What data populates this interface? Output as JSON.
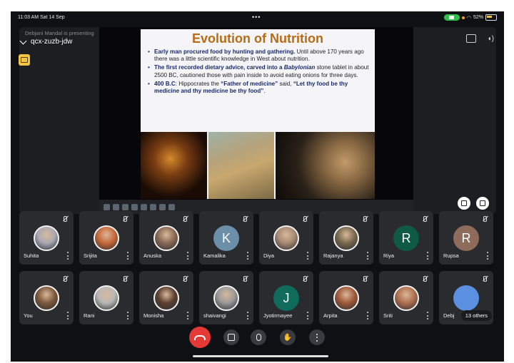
{
  "status": {
    "time": "11:03 AM  Sat 14 Sep",
    "battery": "52%"
  },
  "meeting": {
    "presenting": "Debjani Mandal is presenting",
    "code": "qcx-zuzb-jdw"
  },
  "slide": {
    "title": "Evolution of Nutrition",
    "b1_bold": "Early man procured food by hunting and gathering.",
    "b1_rest": " Until above 170 years ago there was a little scientific knowledge in West about nutrition.",
    "b2_bold": "The first recorded dietary advice, carved into a ",
    "b2_ital": "Babylonian",
    "b2_rest": " stone tablet in about 2500 BC, cautioned those with pain inside to avoid eating onions for three days.",
    "b3_bold": "400 B.C",
    "b3_mid": ": Hippocrates the ",
    "b3_q1": "“Father of medicine”",
    "b3_said": " said, ",
    "b3_q2": "“Let thy food be thy medicine and thy medicine be thy food”",
    "b3_end": "."
  },
  "participants_row1": [
    {
      "name": "Suhita",
      "initial": "",
      "color": "#a9a9b4"
    },
    {
      "name": "Srijita",
      "initial": "",
      "color": "#c96a3a"
    },
    {
      "name": "Anuska",
      "initial": "",
      "color": "#8b6a55"
    },
    {
      "name": "Kamalika",
      "initial": "K",
      "color": "#6b8fa8"
    },
    {
      "name": "Diya",
      "initial": "",
      "color": "#a88b74"
    },
    {
      "name": "Rajanya",
      "initial": "",
      "color": "#7a6a4e"
    },
    {
      "name": "Riya",
      "initial": "R",
      "color": "#0f5a45"
    },
    {
      "name": "Rupsa",
      "initial": "R",
      "color": "#8e6b5a"
    }
  ],
  "participants_row2": [
    {
      "name": "You",
      "initial": "",
      "color": "#7d5a3c"
    },
    {
      "name": "Rani",
      "initial": "",
      "color": "#b8b8b8"
    },
    {
      "name": "Monisha",
      "initial": "",
      "color": "#5e4030"
    },
    {
      "name": "shaivangi",
      "initial": "",
      "color": "#9a9a9a"
    },
    {
      "name": "Jyotirmayee",
      "initial": "J",
      "color": "#0f6b5a"
    },
    {
      "name": "Arpita",
      "initial": "",
      "color": "#a05a3a"
    },
    {
      "name": "Sriti",
      "initial": "",
      "color": "#b07050"
    },
    {
      "name": "Debj",
      "initial": "",
      "color": "#5b8fe0"
    }
  ],
  "others_badge": "13 others"
}
